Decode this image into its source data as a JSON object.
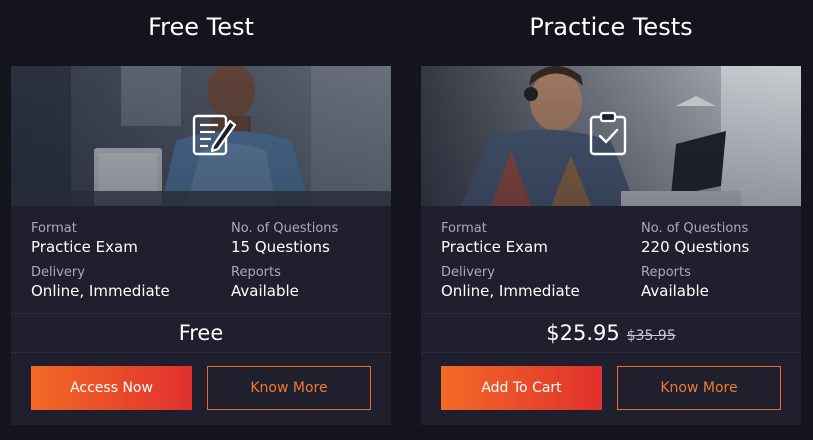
{
  "columns": [
    {
      "title": "Free Test",
      "icon": "edit-document-icon",
      "format_label": "Format",
      "format_value": "Practice Exam",
      "questions_label": "No. of Questions",
      "questions_value": "15 Questions",
      "delivery_label": "Delivery",
      "delivery_value": "Online, Immediate",
      "reports_label": "Reports",
      "reports_value": "Available",
      "price": "Free",
      "old_price": "",
      "primary_button": "Access Now",
      "secondary_button": "Know More"
    },
    {
      "title": "Practice Tests",
      "icon": "clipboard-check-icon",
      "format_label": "Format",
      "format_value": "Practice Exam",
      "questions_label": "No. of Questions",
      "questions_value": "220 Questions",
      "delivery_label": "Delivery",
      "delivery_value": "Online, Immediate",
      "reports_label": "Reports",
      "reports_value": "Available",
      "price": "$25.95",
      "old_price": "$35.95",
      "primary_button": "Add To Cart",
      "secondary_button": "Know More"
    }
  ],
  "colors": {
    "background": "#14141f",
    "card": "#1f1f2d",
    "accent_start": "#f26a24",
    "accent_end": "#e0302f",
    "outline": "#ee6a2c"
  }
}
